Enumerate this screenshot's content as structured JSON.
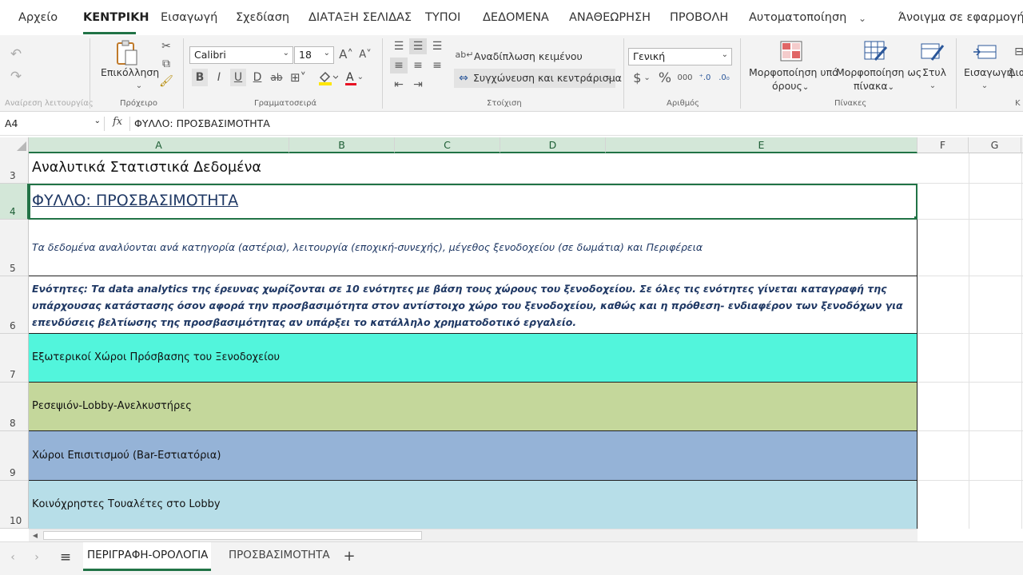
{
  "menu": {
    "file": "Αρχείο",
    "tabs": [
      "ΚΕΝΤΡΙΚΗ",
      "Εισαγωγή",
      "Σχεδίαση",
      "ΔΙΑΤΑΞΗ ΣΕΛΙΔΑΣ",
      "ΤΥΠΟΙ",
      "ΔΕΔΟΜΕΝΑ",
      "ΑΝΑΘΕΩΡΗΣΗ",
      "ΠΡΟΒΟΛΗ",
      "Αυτοματοποίηση"
    ],
    "open_in_app": "Άνοιγμα σε εφαρμογή υπ"
  },
  "ribbon": {
    "undo_group": "Αναίρεση λειτουργίας",
    "clipboard": {
      "paste": "Επικόλληση",
      "group": "Πρόχειρο"
    },
    "font": {
      "name": "Calibri",
      "size": "18",
      "group": "Γραμματοσειρά",
      "bold": "B",
      "italic": "I",
      "underline": "U",
      "double_underline": "D",
      "strike": "ab",
      "font_color_letter": "A"
    },
    "alignment": {
      "wrap": "Αναδίπλωση κειμένου",
      "merge": "Συγχώνευση και κεντράρισμα",
      "group": "Στοίχιση"
    },
    "number": {
      "format": "Γενική",
      "group": "Αριθμός",
      "currency": "$",
      "percent": "%",
      "thousands": "000"
    },
    "tables": {
      "cond_format_1": "Μορφοποίηση υπό",
      "cond_format_2": "όρους",
      "format_table_1": "Μορφοποίηση ως",
      "format_table_2": "πίνακα",
      "styles": "Στυλ",
      "group": "Πίνακες"
    },
    "cells": {
      "insert": "Εισαγωγή",
      "delete": "Δια",
      "group": "Κ"
    }
  },
  "formula_bar": {
    "name_box": "A4",
    "fx": "fx",
    "content": "ΦΥΛΛΟ: ΠΡΟΣΒΑΣΙΜΟΤΗΤΑ"
  },
  "columns": [
    "A",
    "B",
    "C",
    "D",
    "E",
    "F",
    "G"
  ],
  "rows": [
    {
      "num": "3",
      "text": "Αναλυτικά Στατιστικά Δεδομένα"
    },
    {
      "num": "4",
      "text": "ΦΥΛΛΟ: ΠΡΟΣΒΑΣΙΜΟΤΗΤΑ"
    },
    {
      "num": "5",
      "text": "Τα δεδομένα αναλύονται ανά κατηγορία (αστέρια), λειτουργία (εποχική-συνεχής), μέγεθος ξενοδοχείου (σε δωμάτια) και Περιφέρεια"
    },
    {
      "num": "6",
      "text": "Ενότητες: Τα data analytics της έρευνας χωρίζονται σε 10 ενότητες με βάση τους χώρους του ξενοδοχείου. Σε όλες τις ενότητες γίνεται καταγραφή της υπάρχουσας κατάστασης όσον αφορά την προσβασιμότητα στον αντίστοιχο χώρο του ξενοδοχείου, καθώς και η πρόθεση- ενδιαφέρον των ξενοδόχων για επενδύσεις βελτίωσης της προσβασιμότητας αν υπάρξει το κατάλληλο χρηματοδοτικό εργαλείο."
    },
    {
      "num": "7",
      "text": "Εξωτερικοί Χώροι Πρόσβασης του Ξενοδοχείου",
      "fill": "#52f5dc"
    },
    {
      "num": "8",
      "text": "Ρεσεψιόν-Lobby-Ανελκυστήρες",
      "fill": "#c4d79b"
    },
    {
      "num": "9",
      "text": "Χώροι Επισιτισμού (Bar-Εστιατόρια)",
      "fill": "#95b3d7"
    },
    {
      "num": "10",
      "text": "Κοινόχρηστες Τουαλέτες στο Lobby",
      "fill": "#b7dee8"
    }
  ],
  "sheet_tabs": [
    "ΠΕΡΙΓΡΑΦΗ-ΟΡΟΛΟΓΙΑ",
    "ΠΡΟΣΒΑΣΙΜΟΤΗΤΑ"
  ],
  "colors": {
    "accent": "#217346",
    "title_blue": "#1f3864",
    "italic_blue": "#1f3864"
  }
}
